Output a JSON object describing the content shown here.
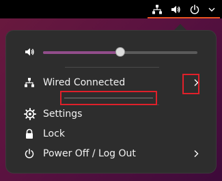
{
  "topbar": {
    "icons": [
      "network-wired-icon",
      "speaker-icon",
      "power-icon",
      "chevron-down-icon"
    ]
  },
  "menu": {
    "volume": {
      "icon": "speaker-icon",
      "level_fraction": 0.5
    },
    "network": {
      "label": "Wired Connected",
      "icon": "network-wired-icon"
    },
    "settings": {
      "label": "Settings",
      "icon": "gear-icon"
    },
    "lock": {
      "label": "Lock",
      "icon": "lock-icon"
    },
    "power": {
      "label": "Power Off / Log Out",
      "icon": "power-icon"
    }
  },
  "colors": {
    "accent": "#e95420",
    "slider_fill": "#924d8b",
    "highlight": "#e0202a",
    "menu_bg": "#2d2d2d"
  }
}
